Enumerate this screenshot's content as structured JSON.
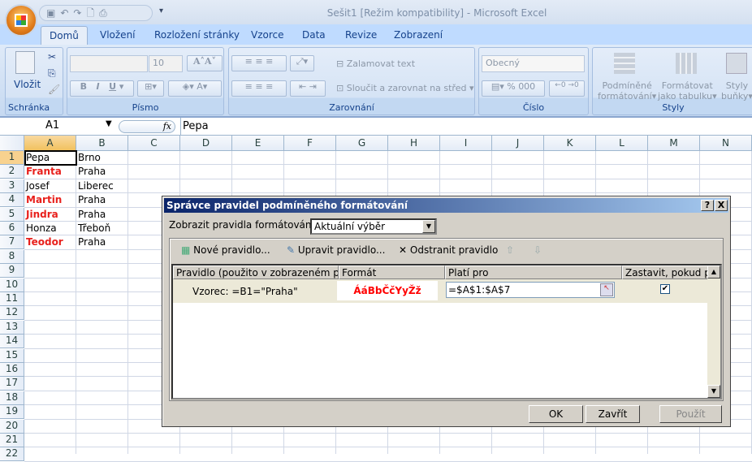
{
  "window": {
    "title": "Sešit1  [Režim kompatibility] - Microsoft Excel"
  },
  "tabs": [
    "Domů",
    "Vložení",
    "Rozložení stránky",
    "Vzorce",
    "Data",
    "Revize",
    "Zobrazení"
  ],
  "ribbon": {
    "clipboard": {
      "label": "Schránka",
      "paste": "Vložit"
    },
    "font": {
      "label": "Písmo",
      "size": "10",
      "bold": "B",
      "italic": "I",
      "underline": "U"
    },
    "alignment": {
      "label": "Zarovnání",
      "wrap": "Zalamovat text",
      "merge": "Sloučit a zarovnat na střed"
    },
    "number": {
      "label": "Číslo",
      "format": "Obecný",
      "percent": "%",
      "thousands": "000"
    },
    "styles": {
      "label": "Styly",
      "cond1": "Podmíněné",
      "cond2": "formátování",
      "table1": "Formátovat",
      "table2": "jako tabulku",
      "cell1": "Styly",
      "cell2": "buňky"
    }
  },
  "formula_bar": {
    "name_box": "A1",
    "fx": "fx",
    "value": "Pepa"
  },
  "columns": [
    "A",
    "B",
    "C",
    "D",
    "E",
    "F",
    "G",
    "H",
    "I",
    "J",
    "K",
    "L",
    "M",
    "N"
  ],
  "rows": [
    "1",
    "2",
    "3",
    "4",
    "5",
    "6",
    "7",
    "8",
    "9",
    "10",
    "11",
    "12",
    "13",
    "14",
    "15",
    "16",
    "17",
    "18",
    "19",
    "20",
    "21",
    "22"
  ],
  "cells": [
    {
      "a": "Pepa",
      "b": "Brno",
      "red": false
    },
    {
      "a": "Franta",
      "b": "Praha",
      "red": true
    },
    {
      "a": "Josef",
      "b": "Liberec",
      "red": false
    },
    {
      "a": "Martin",
      "b": "Praha",
      "red": true
    },
    {
      "a": "Jindra",
      "b": "Praha",
      "red": true
    },
    {
      "a": "Honza",
      "b": "Třeboň",
      "red": false
    },
    {
      "a": "Teodor",
      "b": "Praha",
      "red": true
    }
  ],
  "dialog": {
    "title": "Správce pravidel podmíněného formátování",
    "help": "?",
    "close": "X",
    "show_label": "Zobrazit pravidla formátování pro:",
    "show_value": "Aktuální výběr",
    "new_rule": "Nové pravidlo...",
    "edit_rule": "Upravit pravidlo...",
    "delete_rule": "Odstranit pravidlo",
    "headers": [
      "Pravidlo (použito v zobrazeném pořadí)",
      "Formát",
      "Platí pro",
      "Zastavit, pokud platí"
    ],
    "rule": {
      "text": "Vzorec: =B1=\"Praha\"",
      "format_preview": "ÁáBbČčYyŽž",
      "applies_to": "=$A$1:$A$7",
      "stop": true
    },
    "ok": "OK",
    "close_btn": "Zavřít",
    "apply": "Použít",
    "preview_color": "#ff0000"
  }
}
